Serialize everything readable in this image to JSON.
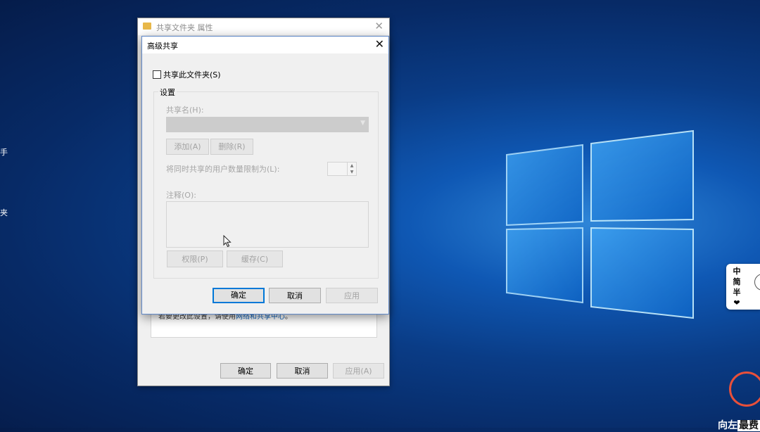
{
  "desktop": {
    "left_labels": [
      "手",
      "夹"
    ]
  },
  "properties_window": {
    "title": "共享文件夹 属性",
    "close": "✕",
    "hint_prefix": "若要更改此设置，请使用",
    "hint_link": "网络和共享中心",
    "hint_suffix": "。",
    "ok": "确定",
    "cancel": "取消",
    "apply": "应用(A)"
  },
  "dialog": {
    "title": "高级共享",
    "close": "✕",
    "share_checkbox_label": "共享此文件夹(S)",
    "settings_group": "设置",
    "share_name_label": "共享名(H):",
    "add_button": "添加(A)",
    "remove_button": "删除(R)",
    "user_limit_label": "将同时共享的用户数量限制为(L):",
    "comment_label": "注释(O):",
    "permissions_button": "权限(P)",
    "caching_button": "缓存(C)",
    "ok": "确定",
    "cancel": "取消",
    "apply": "应用"
  },
  "ime": {
    "items": [
      "中",
      "简",
      "半",
      "❤"
    ]
  },
  "watermark": {
    "text_a": "向左",
    "text_b": "最费"
  },
  "colors": {
    "accent": "#0078d7",
    "desktop_blue": "#0a3c86"
  }
}
